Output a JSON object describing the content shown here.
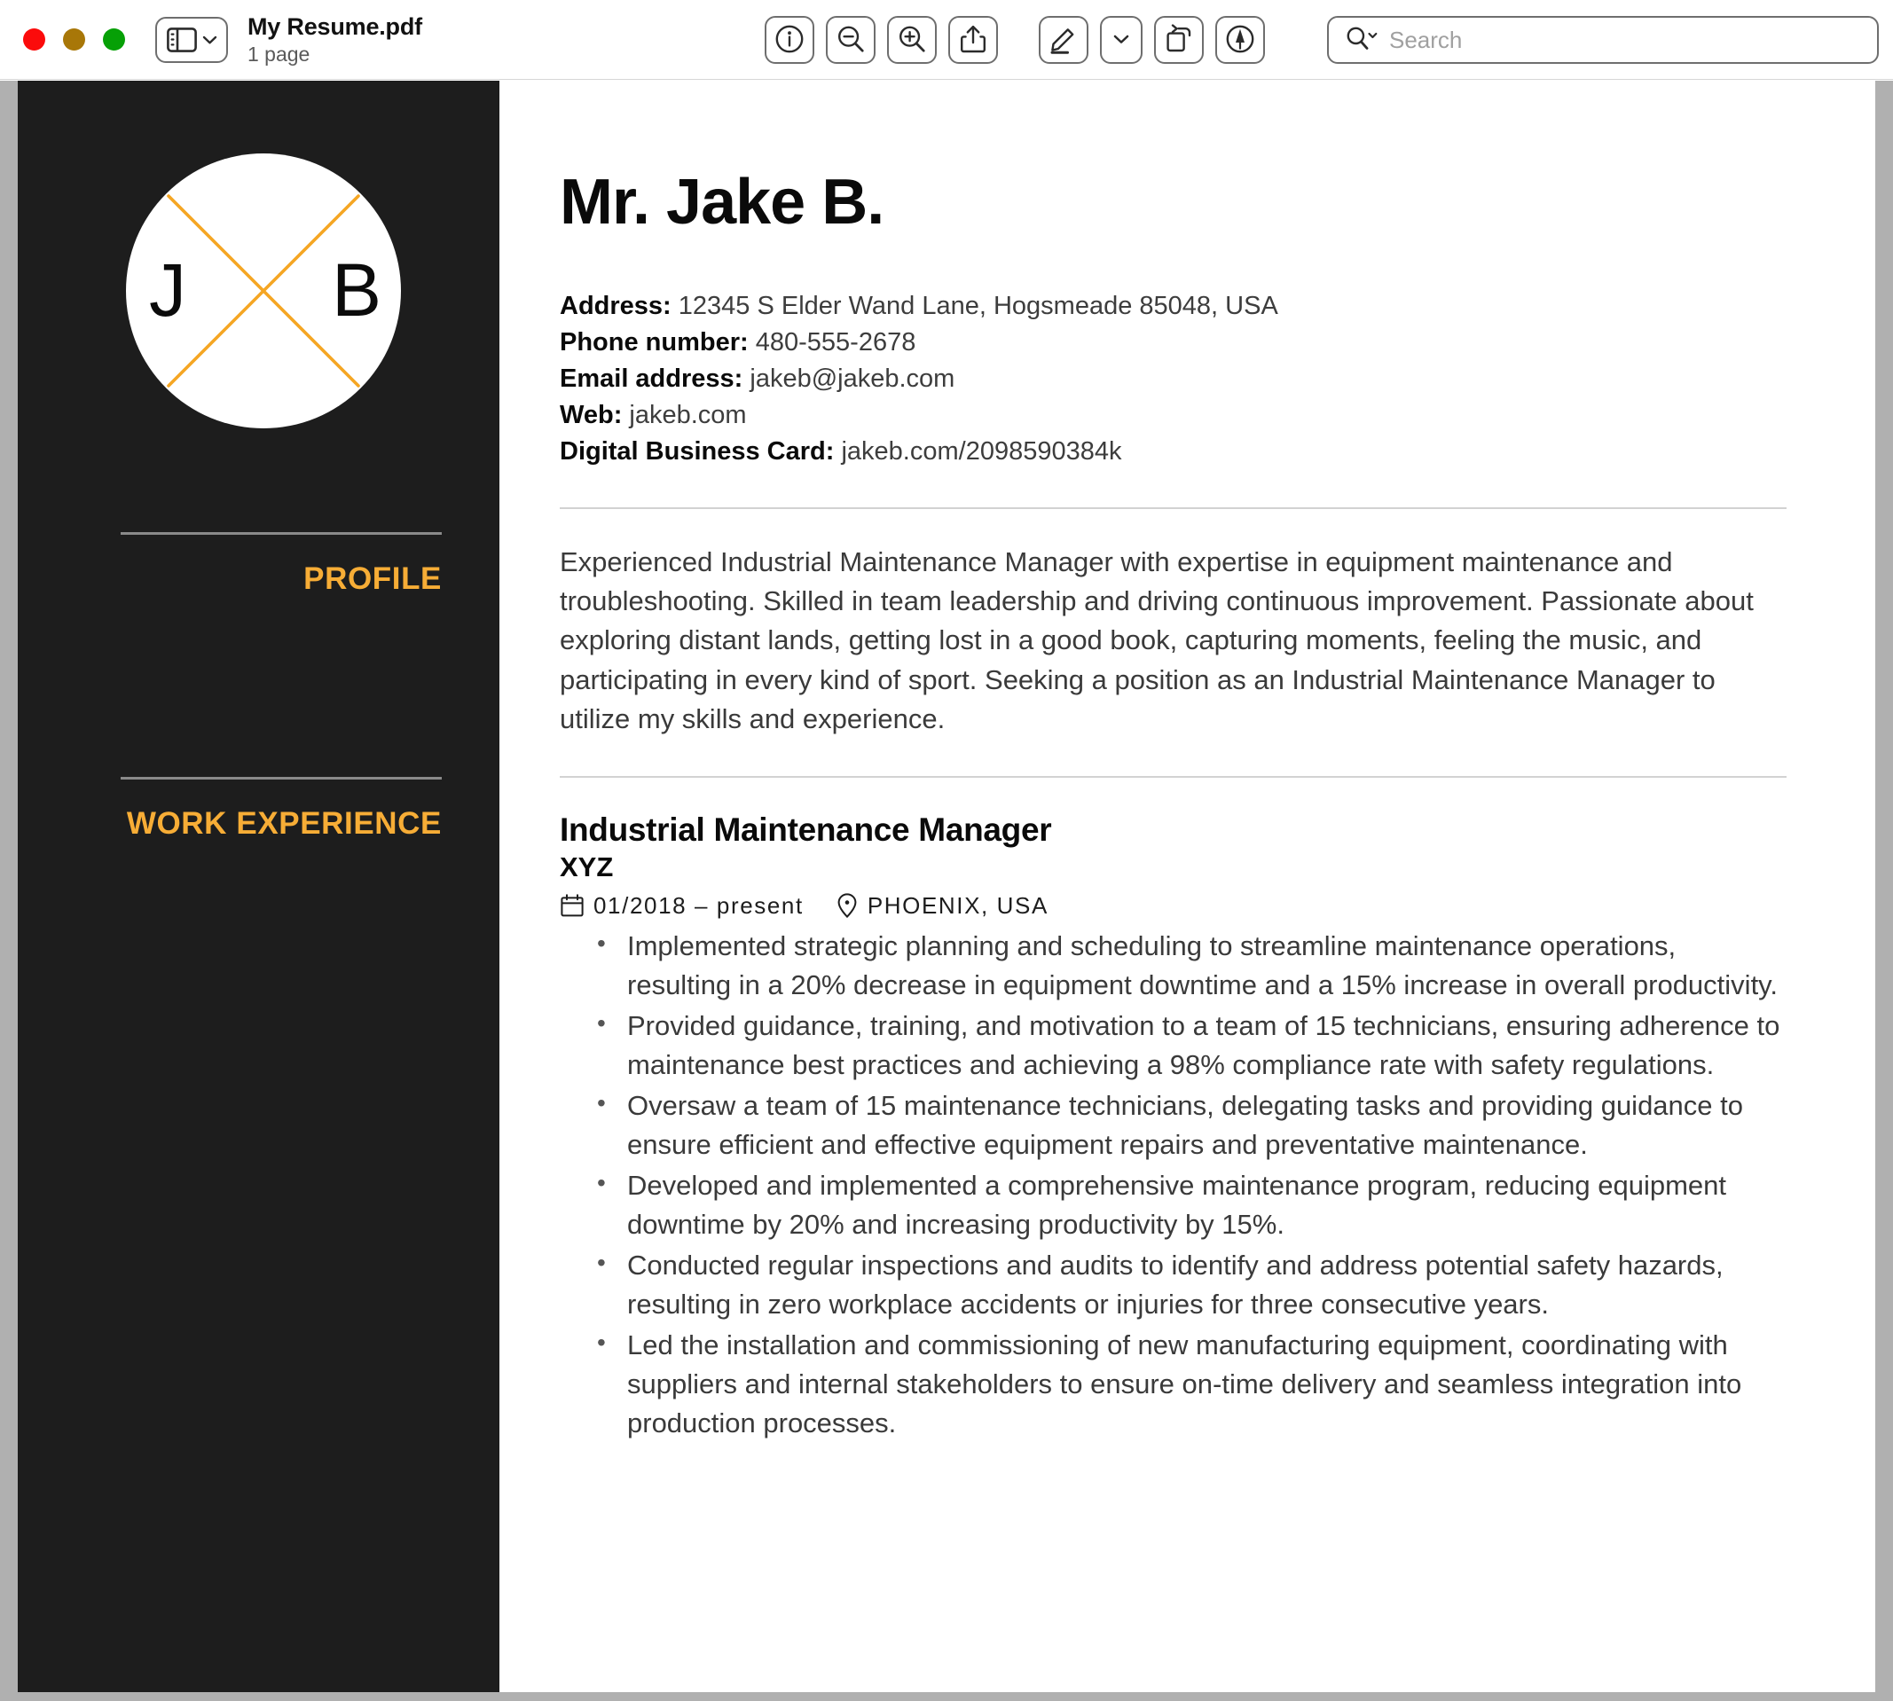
{
  "window": {
    "traffic_lights": [
      "close",
      "minimize",
      "maximize"
    ],
    "document_title": "My Resume.pdf",
    "page_count_label": "1 page"
  },
  "toolbar": {
    "buttons": [
      {
        "name": "info-button",
        "icon": "info-icon",
        "label": "Info"
      },
      {
        "name": "zoom-out-button",
        "icon": "magnifier-minus-icon",
        "label": "Zoom Out"
      },
      {
        "name": "zoom-in-button",
        "icon": "magnifier-plus-icon",
        "label": "Zoom In"
      },
      {
        "name": "share-button",
        "icon": "share-icon",
        "label": "Share"
      },
      {
        "name": "markup-button",
        "icon": "pencil-underline-icon",
        "label": "Show Markup Toolbar"
      },
      {
        "name": "markup-options-button",
        "icon": "chevron-down-icon",
        "label": "Markup Options"
      },
      {
        "name": "rotate-button",
        "icon": "rotate-left-icon",
        "label": "Rotate Left"
      },
      {
        "name": "annotate-button",
        "icon": "annotate-pen-circle-icon",
        "label": "Annotate"
      }
    ],
    "search": {
      "icon": "search-icon",
      "placeholder": "Search",
      "value": ""
    }
  },
  "resume": {
    "logo": {
      "initial_left": "J",
      "initial_right": "B",
      "x_color": "#f5a623",
      "circle_color": "#ffffff"
    },
    "rail_sections": [
      {
        "heading": "PROFILE"
      },
      {
        "heading": "WORK EXPERIENCE"
      }
    ],
    "accent_color": "#f7ad36",
    "rail_color": "#1d1d1d",
    "name": "Mr. Jake B.",
    "contact": [
      {
        "label": "Address:",
        "value": "12345 S Elder Wand Lane, Hogsmeade 85048, USA"
      },
      {
        "label": "Phone number:",
        "value": "480-555-2678"
      },
      {
        "label": "Email address:",
        "value": "jakeb@jakeb.com"
      },
      {
        "label": "Web:",
        "value": "jakeb.com"
      },
      {
        "label": "Digital Business Card:",
        "value": "jakeb.com/2098590384k"
      }
    ],
    "summary": "Experienced Industrial Maintenance Manager with expertise in equipment maintenance and troubleshooting. Skilled in team leadership and driving continuous improvement. Passionate about exploring distant lands, getting lost in a good book, capturing moments, feeling the music, and participating in every kind of sport. Seeking a position as an Industrial Maintenance Manager to utilize my skills and experience.",
    "experience": {
      "title": "Industrial Maintenance Manager",
      "company": "XYZ",
      "dates": "01/2018 – present",
      "location": "PHOENIX, USA",
      "date_icon": "calendar-icon",
      "location_icon": "map-pin-icon",
      "bullets": [
        "Implemented strategic planning and scheduling to streamline maintenance operations, resulting in a 20% decrease in equipment downtime and a 15% increase in overall productivity.",
        "Provided guidance, training, and motivation to a team of 15 technicians, ensuring adherence to maintenance best practices and achieving a 98% compliance rate with safety regulations.",
        "Oversaw a team of 15 maintenance technicians, delegating tasks and providing guidance to ensure efficient and effective equipment repairs and preventative maintenance.",
        "Developed and implemented a comprehensive maintenance program, reducing equipment downtime by 20% and increasing productivity by 15%.",
        "Conducted regular inspections and audits to identify and address potential safety hazards, resulting in zero workplace accidents or injuries for three consecutive years.",
        "Led the installation and commissioning of new manufacturing equipment, coordinating with suppliers and internal stakeholders to ensure on-time delivery and seamless integration into production processes."
      ]
    }
  }
}
